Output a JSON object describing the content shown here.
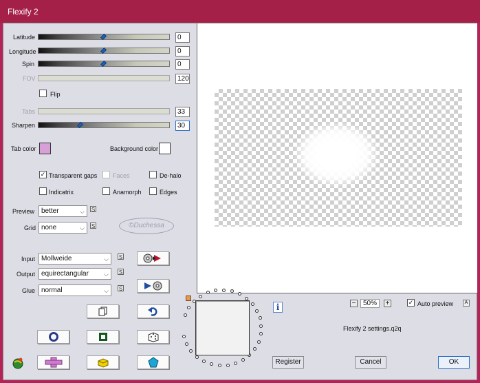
{
  "window": {
    "title": "Flexify 2"
  },
  "sliders": {
    "latitude": {
      "label": "Latitude",
      "value": "0"
    },
    "longitude": {
      "label": "Longitude",
      "value": "0"
    },
    "spin": {
      "label": "Spin",
      "value": "0"
    },
    "fov": {
      "label": "FOV",
      "value": "120"
    },
    "tabs": {
      "label": "Tabs",
      "value": "33"
    },
    "sharpen": {
      "label": "Sharpen",
      "value": "30"
    }
  },
  "flip": {
    "label": "Flip",
    "checked": false
  },
  "colors": {
    "tab_color_label": "Tab color",
    "tab_color": "#d7a0d6",
    "background_color_label": "Background color",
    "background_color": "#ffffff"
  },
  "options": {
    "transparent_gaps": {
      "label": "Transparent gaps",
      "checked": true
    },
    "faces": {
      "label": "Faces",
      "checked": false,
      "disabled": true
    },
    "de_halo": {
      "label": "De-halo",
      "checked": false
    },
    "indicatrix": {
      "label": "Indicatrix",
      "checked": false
    },
    "anamorph": {
      "label": "Anamorph",
      "checked": false
    },
    "edges": {
      "label": "Edges",
      "checked": false
    }
  },
  "preview_quality": {
    "label": "Preview",
    "value": "better"
  },
  "grid": {
    "label": "Grid",
    "value": "none"
  },
  "watermark": "©Duchessa",
  "projection": {
    "input": {
      "label": "Input",
      "value": "Mollweide"
    },
    "output": {
      "label": "Output",
      "value": "equirectangular"
    },
    "glue": {
      "label": "Glue",
      "value": "normal"
    }
  },
  "zoom": {
    "minus": "−",
    "value": "50%",
    "plus": "+"
  },
  "auto_preview": {
    "label": "Auto preview",
    "checked": true
  },
  "settings_file": "Flexify 2 settings.q2q",
  "buttons": {
    "register": "Register",
    "cancel": "Cancel",
    "ok": "OK"
  },
  "glyphs": {
    "check": "✓",
    "arrow": "⌵",
    "sync": "S",
    "info": "i",
    "help": "A"
  }
}
